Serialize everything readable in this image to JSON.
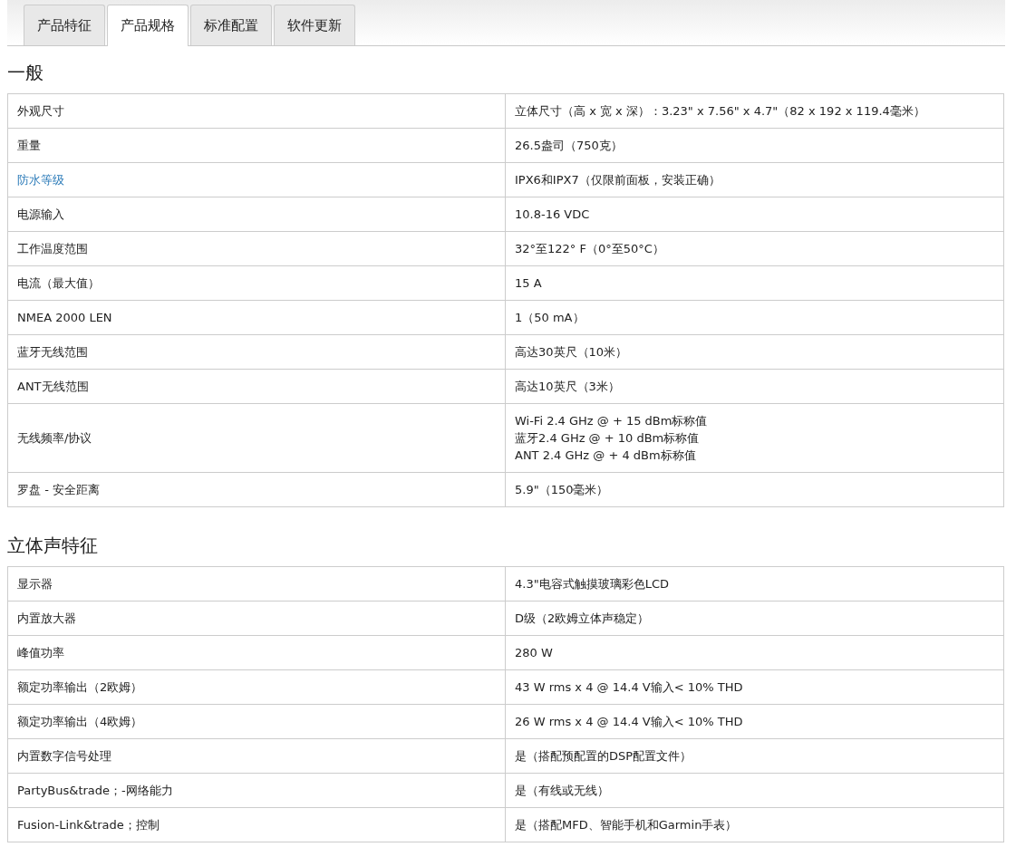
{
  "tabs": [
    {
      "label": "产品特征",
      "selected": false
    },
    {
      "label": "产品规格",
      "selected": true
    },
    {
      "label": "标准配置",
      "selected": false
    },
    {
      "label": "软件更新",
      "selected": false
    }
  ],
  "sections": [
    {
      "title": "一般",
      "rows": [
        {
          "label": "外观尺寸",
          "link": false,
          "value": [
            "立体尺寸（高 x 宽 x 深）：3.23\" x 7.56\" x 4.7\"（82 x 192 x 119.4毫米）"
          ]
        },
        {
          "label": "重量",
          "link": false,
          "value": [
            "26.5盎司（750克）"
          ]
        },
        {
          "label": "防水等级",
          "link": true,
          "value": [
            "IPX6和IPX7（仅限前面板，安装正确）"
          ]
        },
        {
          "label": "电源输入",
          "link": false,
          "value": [
            "10.8-16 VDC"
          ]
        },
        {
          "label": "工作温度范围",
          "link": false,
          "value": [
            "32°至122° F（0°至50°C）"
          ]
        },
        {
          "label": "电流（最大值）",
          "link": false,
          "value": [
            "15 A"
          ]
        },
        {
          "label": "NMEA 2000 LEN",
          "link": false,
          "value": [
            "1（50 mA）"
          ]
        },
        {
          "label": "蓝牙无线范围",
          "link": false,
          "value": [
            "高达30英尺（10米）"
          ]
        },
        {
          "label": "ANT无线范围",
          "link": false,
          "value": [
            "高达10英尺（3米）"
          ]
        },
        {
          "label": "无线频率/协议",
          "link": false,
          "value": [
            "Wi-Fi 2.4 GHz @ + 15 dBm标称值",
            "蓝牙2.4 GHz @ + 10 dBm标称值",
            "ANT 2.4 GHz @ + 4 dBm标称值"
          ]
        },
        {
          "label": "罗盘 - 安全距离",
          "link": false,
          "value": [
            "5.9\"（150毫米）"
          ]
        }
      ]
    },
    {
      "title": "立体声特征",
      "rows": [
        {
          "label": "显示器",
          "link": false,
          "value": [
            "4.3\"电容式触摸玻璃彩色LCD"
          ]
        },
        {
          "label": "内置放大器",
          "link": false,
          "value": [
            "D级（2欧姆立体声稳定）"
          ]
        },
        {
          "label": "峰值功率",
          "link": false,
          "value": [
            "280 W"
          ]
        },
        {
          "label": "额定功率输出（2欧姆）",
          "link": false,
          "value": [
            "43 W rms x 4 @ 14.4 V输入< 10% THD"
          ]
        },
        {
          "label": "额定功率输出（4欧姆）",
          "link": false,
          "value": [
            "26 W rms x 4 @ 14.4 V输入< 10% THD"
          ]
        },
        {
          "label": "内置数字信号处理",
          "link": false,
          "value": [
            "是（搭配预配置的DSP配置文件）"
          ]
        },
        {
          "label": "PartyBus&trade；-网络能力",
          "link": false,
          "value": [
            "是（有线或无线）"
          ]
        },
        {
          "label": "Fusion-Link&trade；控制",
          "link": false,
          "value": [
            "是（搭配MFD、智能手机和Garmin手表）"
          ]
        }
      ]
    }
  ]
}
